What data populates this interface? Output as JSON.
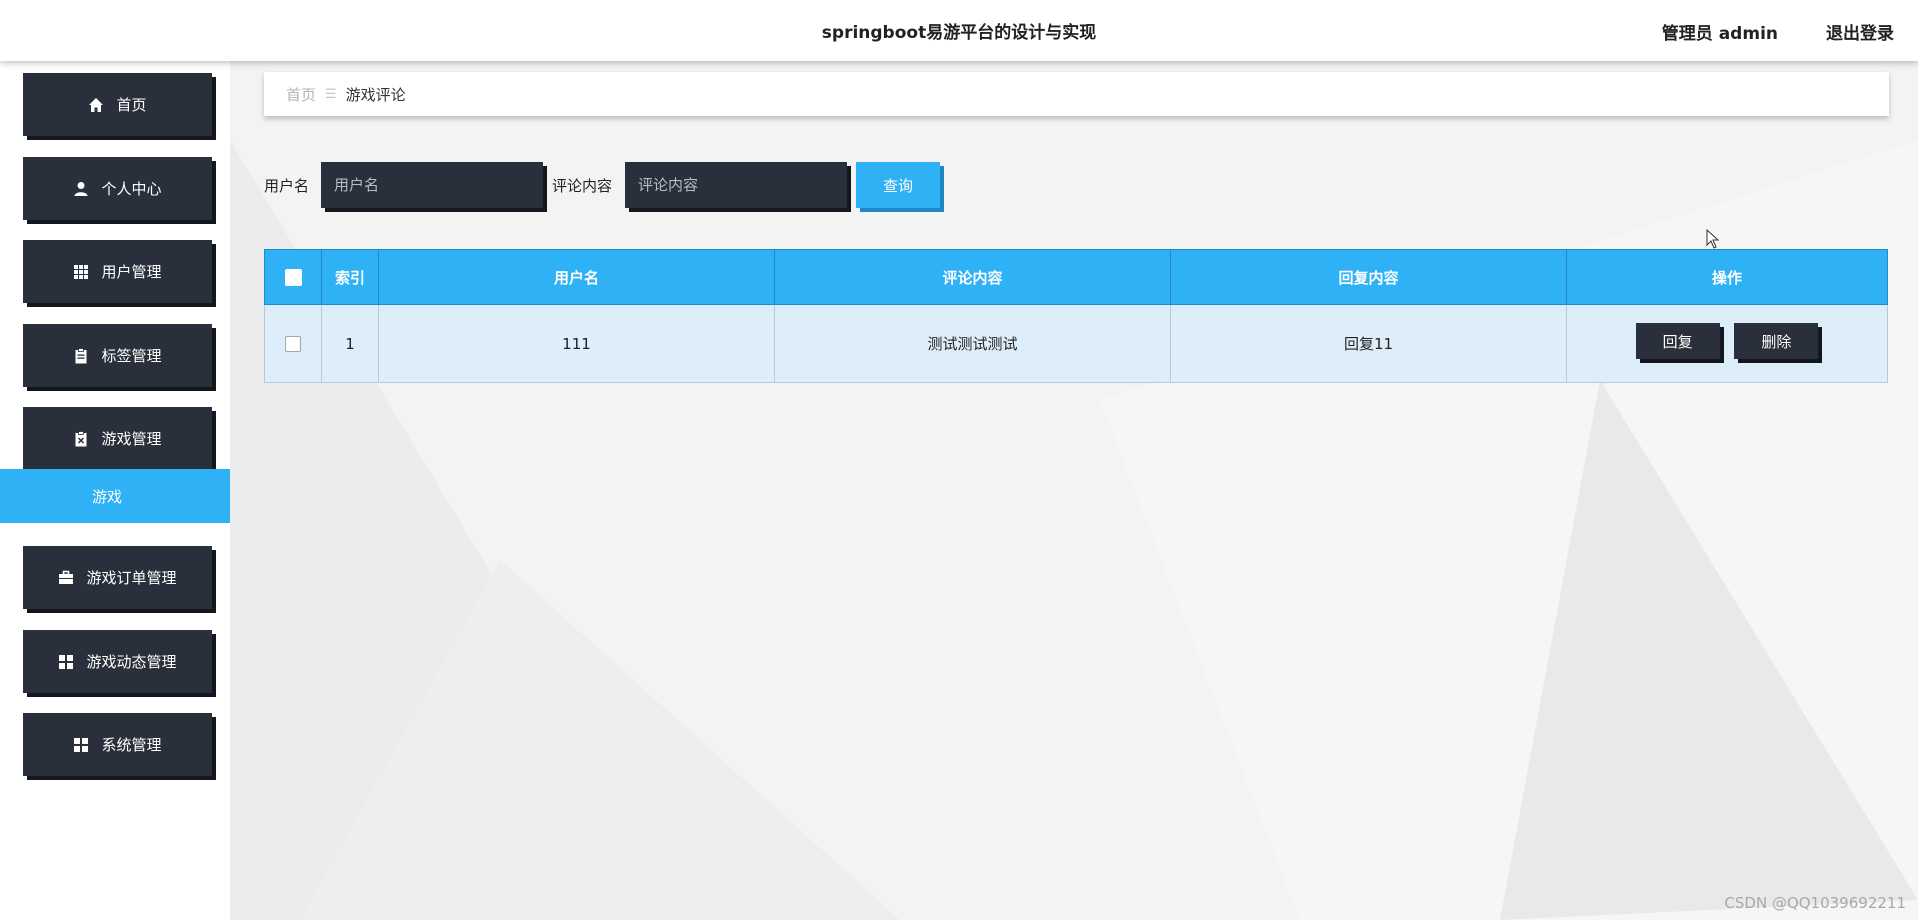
{
  "header": {
    "title": "springboot易游平台的设计与实现",
    "user": "管理员 admin",
    "logout": "退出登录"
  },
  "sidebar": {
    "items": [
      {
        "label": "首页",
        "icon": "home-icon"
      },
      {
        "label": "个人中心",
        "icon": "user-icon"
      },
      {
        "label": "用户管理",
        "icon": "grid-icon"
      },
      {
        "label": "标签管理",
        "icon": "clipboard-icon"
      },
      {
        "label": "游戏管理",
        "icon": "clipboard-x-icon"
      },
      {
        "label": "游戏订单管理",
        "icon": "briefcase-icon"
      },
      {
        "label": "游戏动态管理",
        "icon": "apps-icon"
      },
      {
        "label": "系统管理",
        "icon": "apps-icon"
      }
    ],
    "submenu": {
      "label": "游戏"
    }
  },
  "breadcrumb": {
    "home": "首页",
    "separator": "☰",
    "current": "游戏评论"
  },
  "search": {
    "username_label": "用户名",
    "username_placeholder": "用户名",
    "content_label": "评论内容",
    "content_placeholder": "评论内容",
    "query_button": "查询"
  },
  "table": {
    "headers": [
      "索引",
      "用户名",
      "评论内容",
      "回复内容",
      "操作"
    ],
    "rows": [
      {
        "index": "1",
        "username": "111",
        "comment": "测试测试测试",
        "reply": "回复11"
      }
    ],
    "reply_button": "回复",
    "delete_button": "删除"
  },
  "watermark": "CSDN @QQ1039692211",
  "colors": {
    "accent": "#2fb1f5",
    "dark": "#2a303b",
    "row_bg": "#ddeefa"
  }
}
